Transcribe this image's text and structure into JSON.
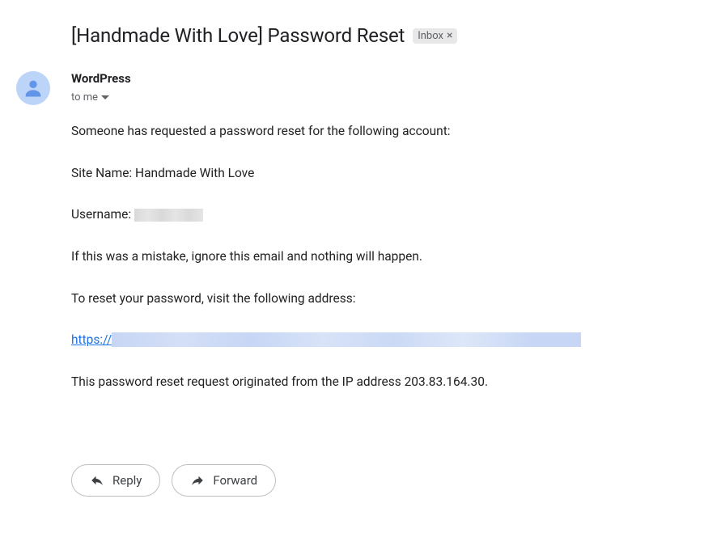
{
  "subject": "[Handmade With Love] Password Reset",
  "badge": {
    "label": "Inbox",
    "close": "×"
  },
  "sender": {
    "name": "WordPress",
    "recipient_prefix": "to me"
  },
  "body": {
    "intro": "Someone has requested a password reset for the following account:",
    "site_line_prefix": "Site Name: ",
    "site_name": "Handmade With Love",
    "username_prefix": "Username: ",
    "mistake_line": "If this was a mistake, ignore this email and nothing will happen.",
    "reset_line": "To reset your password, visit the following address:",
    "link_visible": "https://",
    "ip_line_prefix": "This password reset request originated from the IP address ",
    "ip_address": "203.83.164.30",
    "ip_line_suffix": "."
  },
  "actions": {
    "reply": "Reply",
    "forward": "Forward"
  }
}
